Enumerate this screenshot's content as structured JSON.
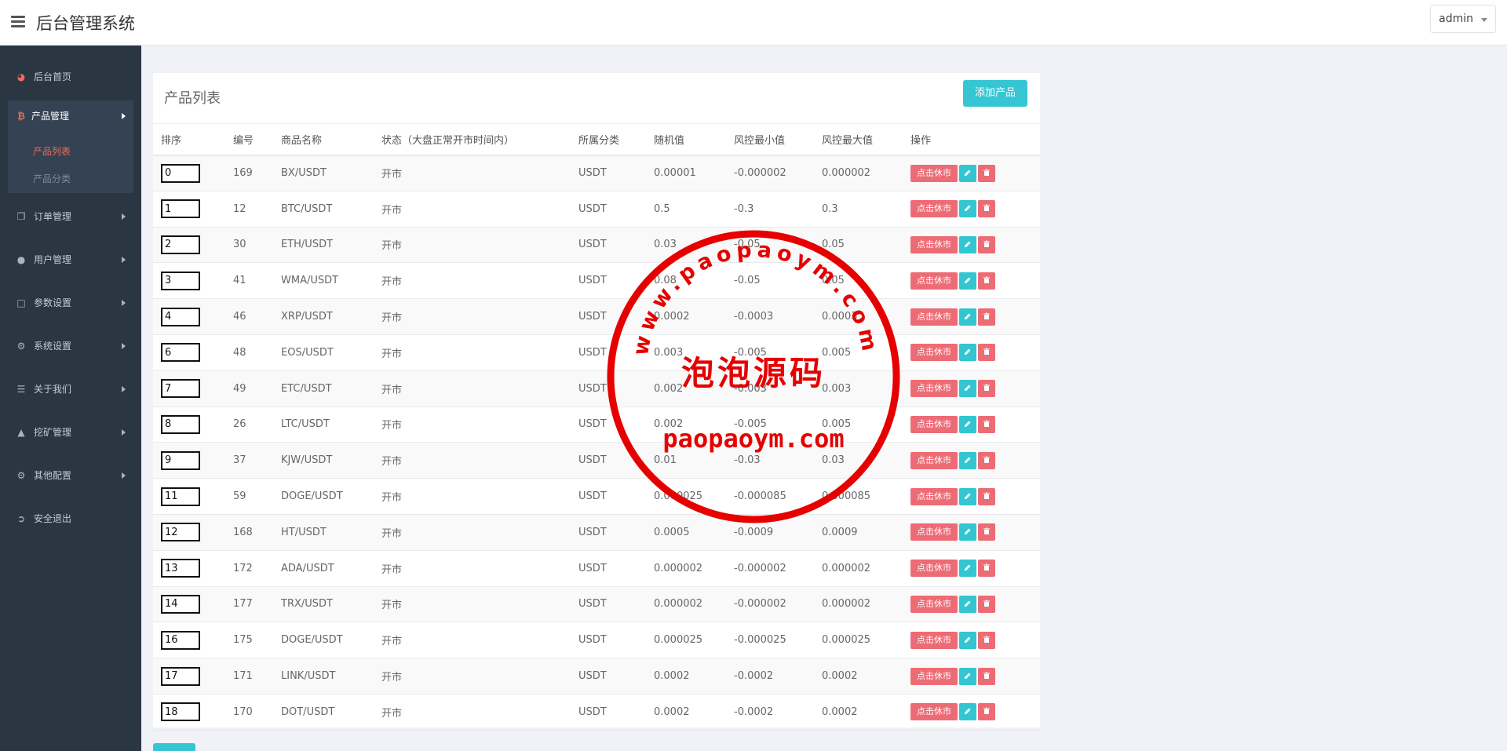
{
  "header": {
    "title": "后台管理系统",
    "user": "admin"
  },
  "sidebar": {
    "items": [
      {
        "label": "后台首页",
        "icon": "dashboard-icon"
      },
      {
        "label": "产品管理",
        "icon": "bitcoin-icon"
      },
      {
        "label": "订单管理",
        "icon": "copy-icon"
      },
      {
        "label": "用户管理",
        "icon": "user-icon"
      },
      {
        "label": "参数设置",
        "icon": "file-icon"
      },
      {
        "label": "系统设置",
        "icon": "cogs-icon"
      },
      {
        "label": "关于我们",
        "icon": "list-icon"
      },
      {
        "label": "挖矿管理",
        "icon": "bell-icon"
      },
      {
        "label": "其他配置",
        "icon": "gear-icon"
      },
      {
        "label": "安全退出",
        "icon": "sign-out-icon"
      }
    ],
    "sub_items": [
      "产品列表",
      "产品分类"
    ]
  },
  "panel": {
    "title": "产品列表",
    "add_button": "添加产品"
  },
  "table": {
    "columns": [
      "排序",
      "编号",
      "商品名称",
      "状态（大盘正常开市时间内）",
      "所属分类",
      "随机值",
      "风控最小值",
      "风控最大值",
      "操作"
    ],
    "close_label": "点击休市",
    "rows": [
      {
        "sort": "0",
        "id": "169",
        "name": "BX/USDT",
        "status": "开市",
        "category": "USDT",
        "random": "0.00001",
        "min": "-0.000002",
        "max": "0.000002"
      },
      {
        "sort": "1",
        "id": "12",
        "name": "BTC/USDT",
        "status": "开市",
        "category": "USDT",
        "random": "0.5",
        "min": "-0.3",
        "max": "0.3"
      },
      {
        "sort": "2",
        "id": "30",
        "name": "ETH/USDT",
        "status": "开市",
        "category": "USDT",
        "random": "0.03",
        "min": "-0.05",
        "max": "0.05"
      },
      {
        "sort": "3",
        "id": "41",
        "name": "WMA/USDT",
        "status": "开市",
        "category": "USDT",
        "random": "0.08",
        "min": "-0.05",
        "max": "0.05"
      },
      {
        "sort": "4",
        "id": "46",
        "name": "XRP/USDT",
        "status": "开市",
        "category": "USDT",
        "random": "0.0002",
        "min": "-0.0003",
        "max": "0.0003"
      },
      {
        "sort": "6",
        "id": "48",
        "name": "EOS/USDT",
        "status": "开市",
        "category": "USDT",
        "random": "0.003",
        "min": "-0.005",
        "max": "0.005"
      },
      {
        "sort": "7",
        "id": "49",
        "name": "ETC/USDT",
        "status": "开市",
        "category": "USDT",
        "random": "0.002",
        "min": "-0.003",
        "max": "0.003"
      },
      {
        "sort": "8",
        "id": "26",
        "name": "LTC/USDT",
        "status": "开市",
        "category": "USDT",
        "random": "0.002",
        "min": "-0.005",
        "max": "0.005"
      },
      {
        "sort": "9",
        "id": "37",
        "name": "KJW/USDT",
        "status": "开市",
        "category": "USDT",
        "random": "0.01",
        "min": "-0.03",
        "max": "0.03"
      },
      {
        "sort": "11",
        "id": "59",
        "name": "DOGE/USDT",
        "status": "开市",
        "category": "USDT",
        "random": "0.000025",
        "min": "-0.000085",
        "max": "0.000085"
      },
      {
        "sort": "12",
        "id": "168",
        "name": "HT/USDT",
        "status": "开市",
        "category": "USDT",
        "random": "0.0005",
        "min": "-0.0009",
        "max": "0.0009"
      },
      {
        "sort": "13",
        "id": "172",
        "name": "ADA/USDT",
        "status": "开市",
        "category": "USDT",
        "random": "0.000002",
        "min": "-0.000002",
        "max": "0.000002"
      },
      {
        "sort": "14",
        "id": "177",
        "name": "TRX/USDT",
        "status": "开市",
        "category": "USDT",
        "random": "0.000002",
        "min": "-0.000002",
        "max": "0.000002"
      },
      {
        "sort": "16",
        "id": "175",
        "name": "DOGE/USDT",
        "status": "开市",
        "category": "USDT",
        "random": "0.000025",
        "min": "-0.000025",
        "max": "0.000025"
      },
      {
        "sort": "17",
        "id": "171",
        "name": "LINK/USDT",
        "status": "开市",
        "category": "USDT",
        "random": "0.0002",
        "min": "-0.0002",
        "max": "0.0002"
      },
      {
        "sort": "18",
        "id": "170",
        "name": "DOT/USDT",
        "status": "开市",
        "category": "USDT",
        "random": "0.0002",
        "min": "-0.0002",
        "max": "0.0002"
      }
    ]
  },
  "watermark": {
    "arc_text": "www.paopaoym.com",
    "center_text": "泡泡源码",
    "bottom_text": "paopaoym.com",
    "color": "#e60000"
  },
  "colors": {
    "accent": "#36c6d3",
    "danger": "#ed6b75",
    "sidebar": "#2b3643"
  }
}
